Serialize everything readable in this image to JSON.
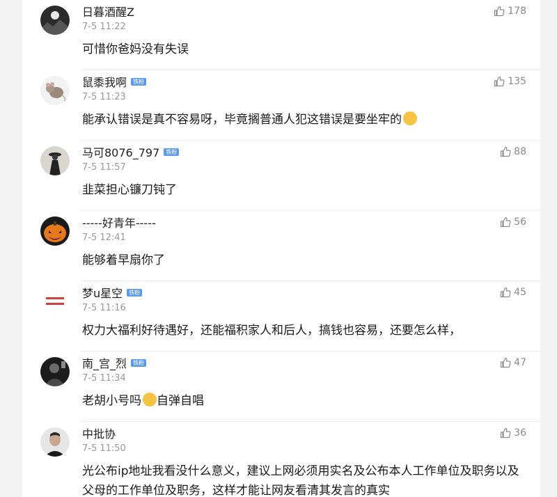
{
  "comments": [
    {
      "username": "日暮酒醒Z",
      "badge": "",
      "time": "7-5 11:22",
      "text": "可惜你爸妈没有失误",
      "likes": "178",
      "avatar": "dark-landscape-avatar"
    },
    {
      "username": "鼠黍我啊",
      "badge": "铁粉",
      "time": "7-5 11:23",
      "text": "能承认错误是真不容易呀，毕竟搁普通人犯这错误是要坐牢的",
      "emoji": "crying-face",
      "likes": "135",
      "avatar": "rat-avatar"
    },
    {
      "username": "马可8076_797",
      "badge": "铁粉",
      "time": "7-5 11:57",
      "text": "韭菜担心镰刀钝了",
      "likes": "88",
      "avatar": "cloaked-figure-avatar"
    },
    {
      "username": "-----好青年-----",
      "badge": "",
      "time": "7-5 12:41",
      "text": "能够着早扇你了",
      "likes": "56",
      "avatar": "pumpkin-avatar"
    },
    {
      "username": "梦u星空",
      "badge": "铁粉",
      "time": "7-5 11:16",
      "text": "权力大福利好待遇好，还能福积家人和后人，搞钱也容易，还要怎么样，",
      "likes": "45",
      "avatar": "text-avatar"
    },
    {
      "username": "南_宫_烈",
      "badge": "铁粉",
      "time": "7-5 11:34",
      "text": "老胡小号吗",
      "emoji": "cat-face",
      "text_after": "自弹自唱",
      "likes": "47",
      "avatar": "dark-photo-avatar"
    },
    {
      "username": "中批协",
      "badge": "",
      "time": "7-5 11:50",
      "text": "光公布ip地址我看没什么意义，建议上网必须用实名及公布本人工作单位及职务以及父母的工作单位及职务，这样才能让网友看清其发言的真实",
      "likes": "36",
      "avatar": "man-portrait-avatar"
    }
  ],
  "colors": {
    "badge": "#5b9bef",
    "time": "#999999",
    "like": "#8a8a8a"
  }
}
